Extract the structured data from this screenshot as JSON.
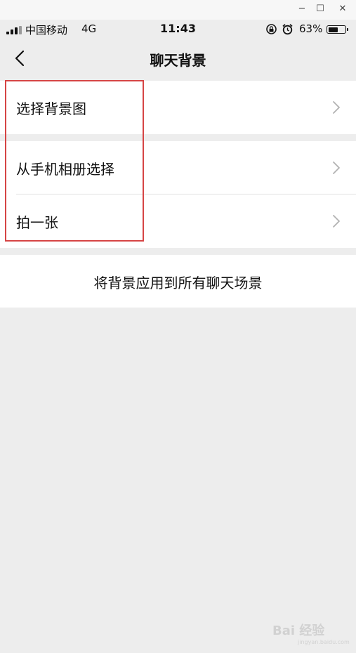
{
  "status_bar": {
    "carrier": "中国移动",
    "network": "4G",
    "time": "11:43",
    "battery_percent": "63%",
    "battery_level": 0.63,
    "icons": [
      "signal-icon",
      "rotation-lock-icon",
      "alarm-icon",
      "battery-icon"
    ]
  },
  "window_controls": {
    "minimize": "−",
    "maximize": "☐",
    "close": "✕"
  },
  "nav": {
    "title": "聊天背景",
    "back_icon": "chevron-left-icon"
  },
  "sections": [
    {
      "items": [
        {
          "label": "选择背景图",
          "icon": "chevron-right-icon"
        }
      ]
    },
    {
      "items": [
        {
          "label": "从手机相册选择",
          "icon": "chevron-right-icon"
        },
        {
          "label": "拍一张",
          "icon": "chevron-right-icon"
        }
      ]
    },
    {
      "items": [
        {
          "label": "将背景应用到所有聊天场景"
        }
      ]
    }
  ],
  "watermark": {
    "text": "Bai 经验",
    "subtext": "jingyan.baidu.com"
  },
  "colors": {
    "highlight": "#d64545",
    "background": "#ededed",
    "cell": "#ffffff"
  }
}
